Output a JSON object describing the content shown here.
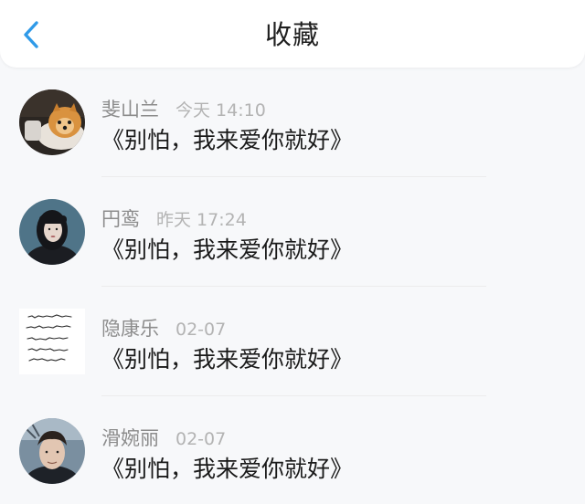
{
  "header": {
    "title": "收藏",
    "back_icon": "chevron-left-icon",
    "accent_color": "#2f9ae8"
  },
  "items": [
    {
      "name": "斐山兰",
      "time": "今天 14:10",
      "content": "《别怕，我来爱你就好》",
      "avatar": "dog-photo"
    },
    {
      "name": "円鸾",
      "time": "昨天 17:24",
      "content": "《别怕，我来爱你就好》",
      "avatar": "woman-portrait"
    },
    {
      "name": "隐康乐",
      "time": "02-07",
      "content": "《别怕，我来爱你就好》",
      "avatar": "handwriting-text"
    },
    {
      "name": "滑婉丽",
      "time": "02-07",
      "content": "《别怕，我来爱你就好》",
      "avatar": "man-portrait"
    }
  ]
}
